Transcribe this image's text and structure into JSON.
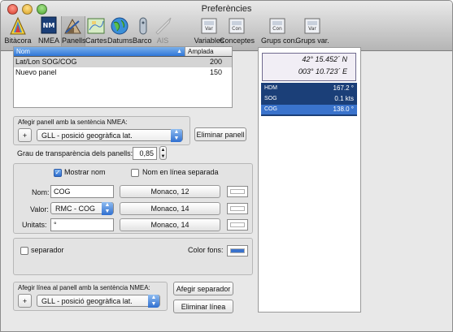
{
  "window": {
    "title": "Preferències"
  },
  "toolbar": {
    "items": [
      {
        "label": "Bitàcora",
        "icon": "bitacora-icon",
        "enabled": true
      },
      {
        "label": "NMEA",
        "icon": "nmea-icon",
        "enabled": true
      },
      {
        "label": "Panells",
        "icon": "panells-icon",
        "enabled": true,
        "selected": true
      },
      {
        "label": "Cartes",
        "icon": "cartes-icon",
        "enabled": true
      },
      {
        "label": "Datums",
        "icon": "globe-icon",
        "enabled": true
      },
      {
        "label": "Barco",
        "icon": "barco-icon",
        "enabled": true
      },
      {
        "label": "AIS",
        "icon": "ais-icon",
        "enabled": false
      },
      {
        "label": "Variables",
        "icon": "variables-icon",
        "enabled": true
      },
      {
        "label": "Conceptes",
        "icon": "conceptes-icon",
        "enabled": true
      },
      {
        "label": "Grups con.",
        "icon": "grups-con-icon",
        "enabled": true
      },
      {
        "label": "Grups var.",
        "icon": "grups-var-icon",
        "enabled": true
      }
    ]
  },
  "panels_table": {
    "columns": [
      "Nom",
      "Amplada"
    ],
    "rows": [
      {
        "name": "Lat/Lon SOG/COG",
        "width": "200",
        "selected": true
      },
      {
        "name": "Nuevo panel",
        "width": "150",
        "selected": false
      }
    ]
  },
  "add_panel": {
    "group_title": "Afegir panell amb la sentència NMEA:",
    "plus_label": "+",
    "sentence": "GLL - posició geogràfica lat.",
    "remove_label": "Eliminar panell"
  },
  "transparency": {
    "label": "Grau de transparència dels panells:",
    "value": "0,85"
  },
  "line_settings": {
    "show_name_label": "Mostrar nom",
    "show_name_checked": true,
    "separate_line_label": "Nom en línea separada",
    "separate_line_checked": false,
    "name_label": "Nom:",
    "name_value": "COG",
    "name_font": "Monaco, 12",
    "value_label": "Valor:",
    "value_select": "RMC - COG",
    "value_font": "Monaco, 14",
    "units_label": "Unitats:",
    "units_value": "°",
    "units_font": "Monaco, 14"
  },
  "separator": {
    "label": "separador",
    "checked": false,
    "color_label": "Color fons:",
    "color": "#3a73cc"
  },
  "add_line": {
    "group_title": "Afegir línea al panell amb la sentència NMEA:",
    "plus_label": "+",
    "sentence": "GLL - posició geogràfica lat.",
    "add_separator_label": "Afegir separador",
    "remove_line_label": "Eliminar línea"
  },
  "preview": {
    "latitude": "42° 15.452´ N",
    "longitude": "003° 10.723´ E",
    "lines": [
      {
        "name": "HDM",
        "value": "167.2 °",
        "selected": false
      },
      {
        "name": "SOG",
        "value": "0.1 kts",
        "selected": false
      },
      {
        "name": "COG",
        "value": "138.0 °",
        "selected": true
      }
    ]
  },
  "colors": {
    "accent": "#3a73cc",
    "panel_bg": "#1b3f78"
  }
}
